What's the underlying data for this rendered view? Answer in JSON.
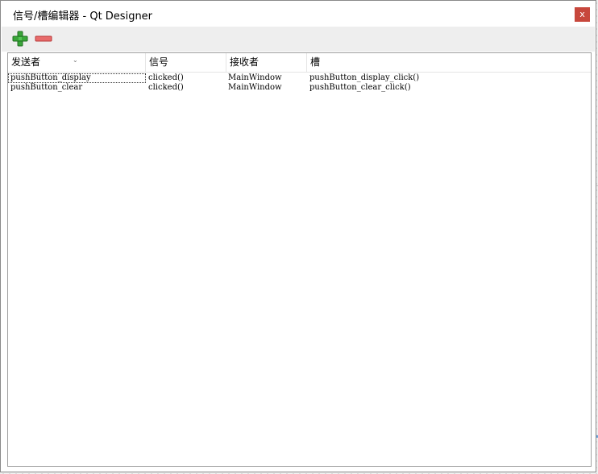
{
  "window": {
    "title": "信号/槽编辑器 - Qt Designer",
    "close_label": "x"
  },
  "toolbar": {
    "add_icon": "add-connection-icon",
    "remove_icon": "remove-connection-icon",
    "add_color": "#3aa63a",
    "remove_color": "#e05555"
  },
  "table": {
    "headers": [
      "发送者",
      "信号",
      "接收者",
      "槽"
    ],
    "rows": [
      [
        "pushButton_display",
        "clicked()",
        "MainWindow",
        "pushButton_display_click()"
      ],
      [
        "pushButton_clear",
        "clicked()",
        "MainWindow",
        "pushButton_clear_click()"
      ]
    ]
  }
}
